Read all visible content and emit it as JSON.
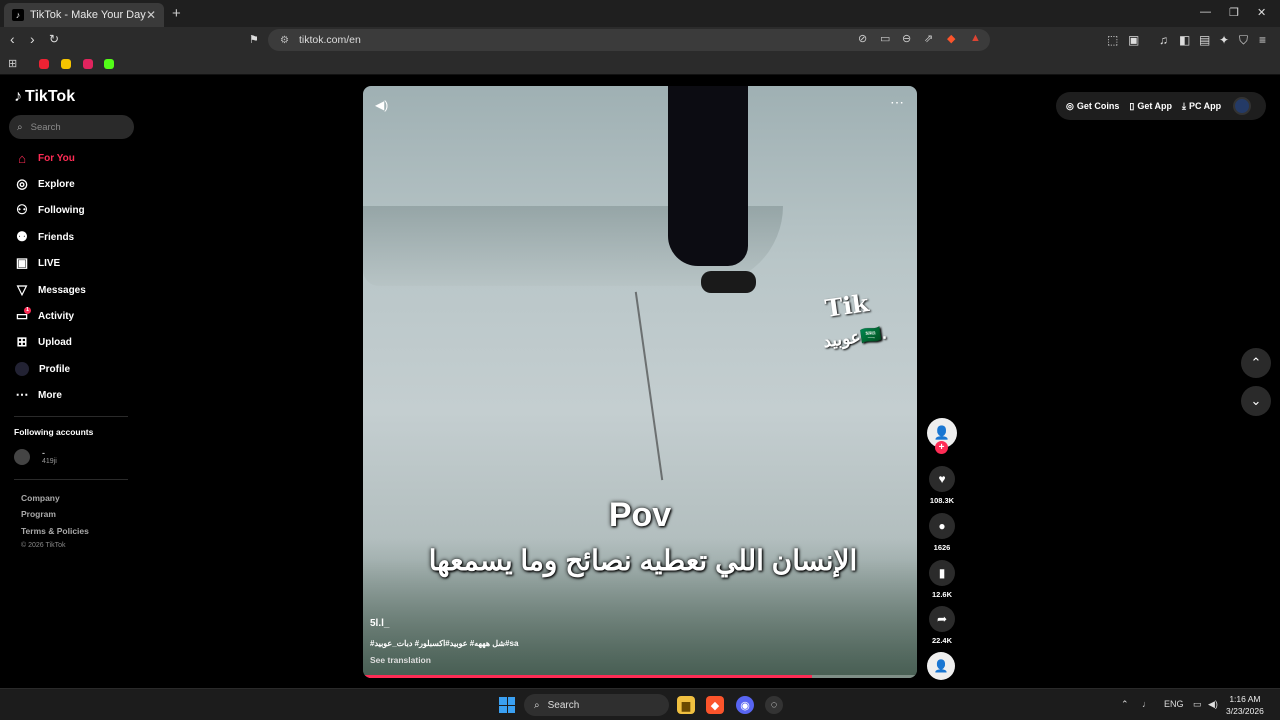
{
  "browser": {
    "tab_title": "TikTok - Make Your Day",
    "tab_close": "✕",
    "new_tab": "+",
    "url": "tiktok.com/en",
    "window_controls": [
      "—",
      "❐",
      "✕"
    ]
  },
  "sidebar": {
    "logo": "TikTok",
    "search_placeholder": "Search",
    "nav": [
      {
        "label": "For You",
        "icon": "home-icon",
        "active": true
      },
      {
        "label": "Explore",
        "icon": "compass-icon"
      },
      {
        "label": "Following",
        "icon": "following-icon"
      },
      {
        "label": "Friends",
        "icon": "friends-icon"
      },
      {
        "label": "LIVE",
        "icon": "live-icon"
      },
      {
        "label": "Messages",
        "icon": "messages-icon"
      },
      {
        "label": "Activity",
        "icon": "activity-icon",
        "badge": "1"
      },
      {
        "label": "Upload",
        "icon": "upload-icon"
      },
      {
        "label": "Profile",
        "icon": "avatar"
      },
      {
        "label": "More",
        "icon": "more-icon"
      }
    ],
    "following_heading": "Following accounts",
    "following_account": {
      "name": "-",
      "handle": "419ji"
    },
    "footer_links": [
      "Company",
      "Program",
      "Terms & Policies"
    ],
    "copyright": "© 2026 TikTok"
  },
  "topbar": {
    "get_coins": "Get Coins",
    "get_app": "Get App",
    "pc_app": "PC App"
  },
  "video": {
    "overlay_brand": "Tik",
    "overlay_brand_ar": "عوبيد🇸🇦.",
    "pov_text": "Pov",
    "caption_ar": "الإنسان اللي تعطيه نصائح وما يسمعها",
    "author": "5l.l_",
    "hashtags": "#شل هههه# عوبيد#اكسبلور# دبات_عوبيد#sa",
    "see_translation": "See translation",
    "progress": 0.81
  },
  "actions": {
    "likes": "108.3K",
    "comments": "1626",
    "bookmarks": "12.6K",
    "shares": "22.4K"
  },
  "taskbar": {
    "search": "Search",
    "lang": "ENG",
    "time": "1:16 AM",
    "date": "3/23/2026"
  },
  "colors": {
    "accent": "#fe2c55",
    "background": "#000000"
  }
}
